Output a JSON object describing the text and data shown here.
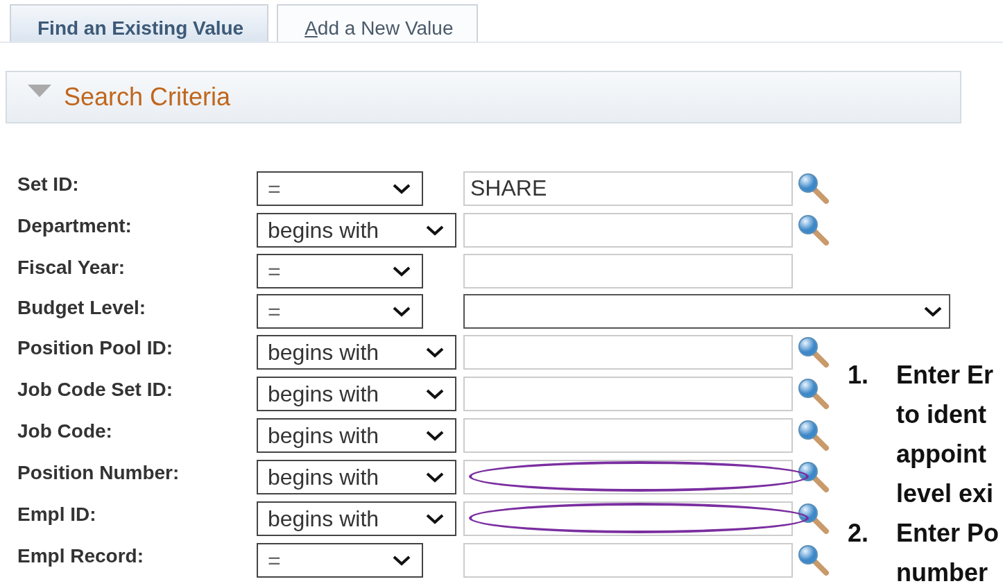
{
  "tabs": [
    {
      "label": "Find an Existing Value",
      "selected": true
    },
    {
      "label": "Add a New Value",
      "selected": false
    }
  ],
  "section": {
    "title": "Search Criteria",
    "expanded": true
  },
  "rows": [
    {
      "label": "Set ID:",
      "operator": "=",
      "kind": "prompt",
      "value": "SHARE",
      "highlighted": false
    },
    {
      "label": "Department:",
      "operator": "begins with",
      "kind": "prompt",
      "highlighted": false
    },
    {
      "label": "Fiscal Year:",
      "operator": "=",
      "kind": "plain",
      "highlighted": false
    },
    {
      "label": "Budget Level:",
      "operator": "=",
      "kind": "dropdown",
      "highlighted": false
    },
    {
      "label": "Position Pool ID:",
      "operator": "begins with",
      "kind": "prompt",
      "highlighted": false
    },
    {
      "label": "Job Code Set ID:",
      "operator": "begins with",
      "kind": "prompt",
      "highlighted": false
    },
    {
      "label": "Job Code:",
      "operator": "begins with",
      "kind": "prompt",
      "highlighted": false
    },
    {
      "label": "Position Number:",
      "operator": "begins with",
      "kind": "prompt",
      "highlighted": true
    },
    {
      "label": "Empl ID:",
      "operator": "begins with",
      "kind": "prompt",
      "highlighted": true
    },
    {
      "label": "Empl Record:",
      "operator": "=",
      "kind": "prompt",
      "highlighted": false
    }
  ],
  "notes": [
    {
      "number": "1.",
      "lines": [
        "Enter Er",
        "to ident",
        "appoint",
        "level exi"
      ]
    },
    {
      "number": "2.",
      "lines": [
        "Enter Po",
        "number"
      ]
    }
  ]
}
